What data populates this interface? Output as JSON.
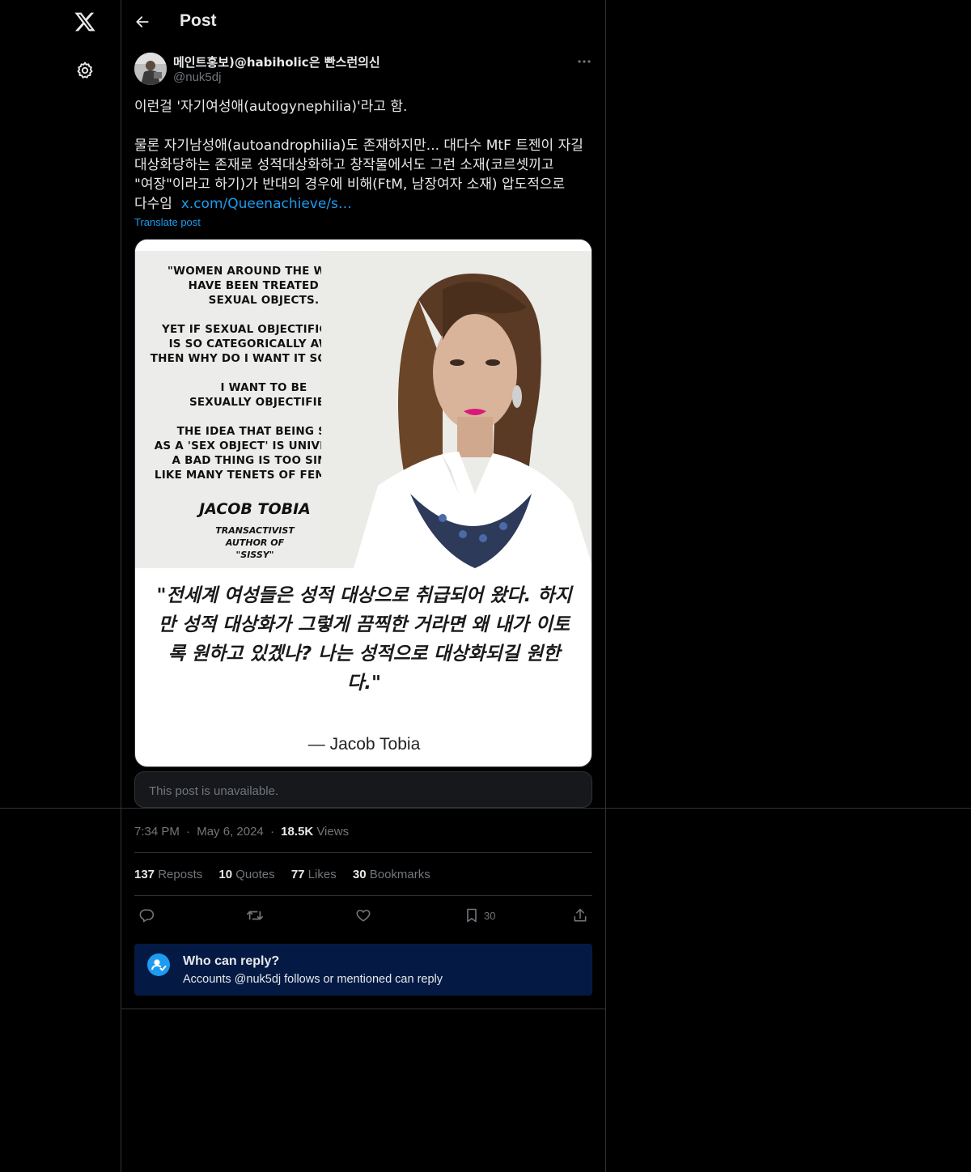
{
  "header": {
    "title": "Post"
  },
  "author": {
    "display_name": "메인트홍보)@habiholic은 빤스런의신",
    "handle": "@nuk5dj"
  },
  "post": {
    "line1": "이런걸 '자기여성애(autogynephilia)'라고 함.",
    "para_lines": [
      "물론 자기남성애(autoandrophilia)도 존재하지만... 대다수 MtF 트젠이 자길",
      "대상화당하는 존재로 성적대상화하고 창작물에서도 그런 소재(코르셋끼고",
      "\"여장\"이라고 하기)가 반대의 경우에 비해(FtM, 남장여자 소재) 압도적으로"
    ],
    "last_line_prefix": "다수임",
    "link_text": "x.com/Queenachieve/s…",
    "translate_label": "Translate post"
  },
  "image": {
    "quote_lines": [
      "\"WOMEN AROUND THE WORLD",
      "HAVE BEEN TREATED AS",
      "SEXUAL OBJECTS.",
      "",
      "YET IF SEXUAL OBJECTIFICATION",
      "IS SO CATEGORICALLY AWFUL,",
      "THEN WHY DO I WANT IT SO BADLY?",
      "",
      "I WANT TO BE",
      "SEXUALLY OBJECTIFIED.",
      "",
      "THE IDEA THAT BEING SEEN",
      "AS A 'SEX OBJECT' IS UNIVERSALLY",
      "A BAD THING IS TOO SIMPLE,",
      "LIKE MANY TENETS OF FEMINISM.\""
    ],
    "author_name": "JACOB TOBIA",
    "author_sub": [
      "TRANSACTIVIST",
      "AUTHOR OF",
      "\"SISSY\""
    ],
    "korean_lines": [
      "\"전세계 여성들은 성적 대상으로 취급되어 왔다. 하지",
      "만 성적 대상화가 그렇게 끔찍한 거라면 왜 내가 이토",
      "록 원하고 있겠나? 나는 성적으로 대상화되길 원한",
      "다.\""
    ],
    "attribution": "— Jacob Tobia"
  },
  "unavailable_notice": "This post is unavailable.",
  "meta": {
    "time": "7:34 PM",
    "dot": "·",
    "date": "May 6, 2024",
    "views_count": "18.5K",
    "views_label": "Views"
  },
  "stats": {
    "reposts_count": "137",
    "reposts_label": "Reposts",
    "quotes_count": "10",
    "quotes_label": "Quotes",
    "likes_count": "77",
    "likes_label": "Likes",
    "bookmarks_count": "30",
    "bookmarks_label": "Bookmarks"
  },
  "actions": {
    "bookmark_count": "30"
  },
  "reply_notice": {
    "title": "Who can reply?",
    "body": "Accounts @nuk5dj follows or mentioned can reply"
  },
  "colors": {
    "background": "#000000",
    "accent": "#1d9bf0",
    "reply_box": "#041a44",
    "muted": "#71767b"
  },
  "icons": [
    "x-logo-icon",
    "settings-gear-icon",
    "back-arrow-icon",
    "more-icon",
    "reply-icon",
    "repost-icon",
    "like-icon",
    "bookmark-icon",
    "share-icon",
    "person-check-icon"
  ]
}
